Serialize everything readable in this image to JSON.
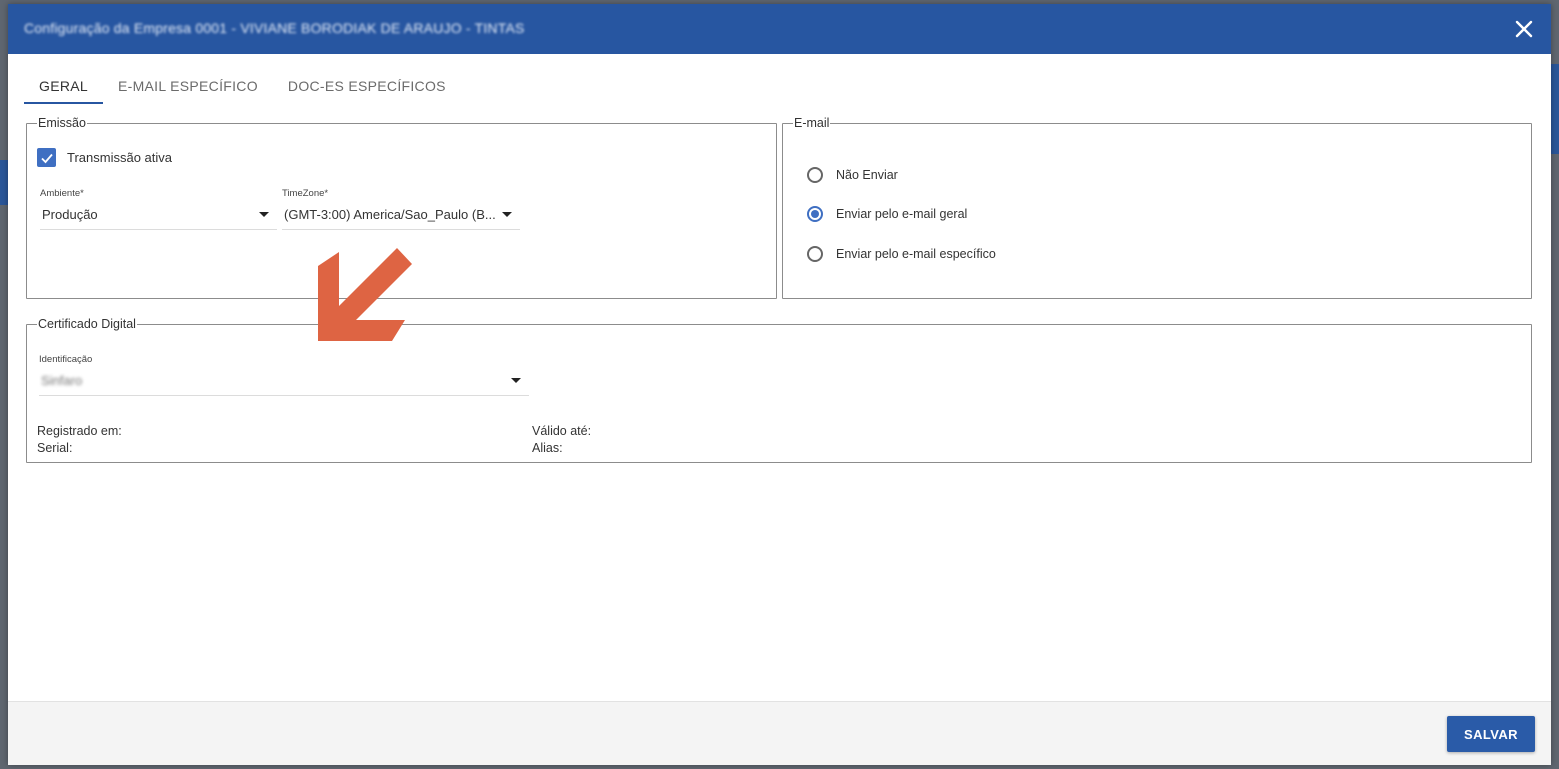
{
  "dialog": {
    "title": "Configuração da Empresa 0001 - VIVIANE BORODIAK DE ARAUJO - TINTAS",
    "close_icon": "close-icon"
  },
  "tabs": [
    {
      "label": "GERAL",
      "active": true
    },
    {
      "label": "E-MAIL ESPECÍFICO",
      "active": false
    },
    {
      "label": "DOC-ES ESPECÍFICOS",
      "active": false
    }
  ],
  "emissao": {
    "legend": "Emissão",
    "transmissao_label": "Transmissão ativa",
    "transmissao_checked": true,
    "ambiente_label": "Ambiente*",
    "ambiente_value": "Produção",
    "timezone_label": "TimeZone*",
    "timezone_value": "(GMT-3:00) America/Sao_Paulo (B..."
  },
  "email": {
    "legend": "E-mail",
    "options": [
      {
        "label": "Não Enviar",
        "checked": false
      },
      {
        "label": "Enviar pelo e-mail geral",
        "checked": true
      },
      {
        "label": "Enviar pelo e-mail específico",
        "checked": false
      }
    ]
  },
  "certificado": {
    "legend": "Certificado Digital",
    "identificacao_label": "Identificação",
    "identificacao_value": "Sinfaro",
    "registrado_label": "Registrado em:",
    "serial_label": "Serial:",
    "valido_label": "Válido até:",
    "alias_label": "Alias:"
  },
  "footer": {
    "save_label": "SALVAR"
  },
  "colors": {
    "primary": "#2756a1",
    "accent": "#3f6fc2",
    "annotation_arrow": "#de6443"
  }
}
